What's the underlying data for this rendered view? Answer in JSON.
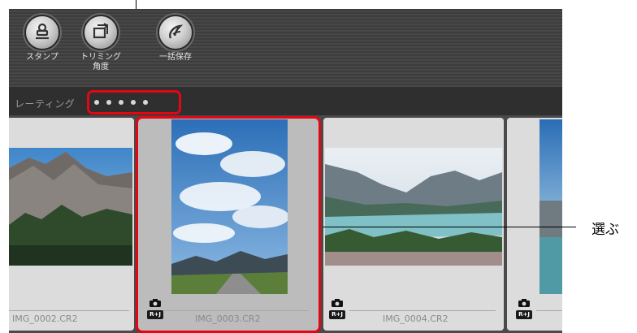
{
  "toolbar": {
    "stamp_label": "スタンプ",
    "trim_label_line1": "トリミング",
    "trim_label_line2": "角度",
    "batch_label": "一括保存"
  },
  "rating": {
    "label": "レーティング",
    "dots_count": 5
  },
  "thumbnails": [
    {
      "filename": "IMG_0002.CR2",
      "badge": "R+J"
    },
    {
      "filename": "IMG_0003.CR2",
      "badge": "R+J",
      "selected": true
    },
    {
      "filename": "IMG_0004.CR2",
      "badge": "R+J"
    },
    {
      "filename": "",
      "badge": "R+J"
    }
  ],
  "callout": {
    "select_label": "選ぶ"
  },
  "colors": {
    "highlight": "#e30613",
    "toolbar_bg": "#3d3d3d",
    "card_bg": "#dcdcdc",
    "selected_card_bg": "#bcbcbc"
  }
}
